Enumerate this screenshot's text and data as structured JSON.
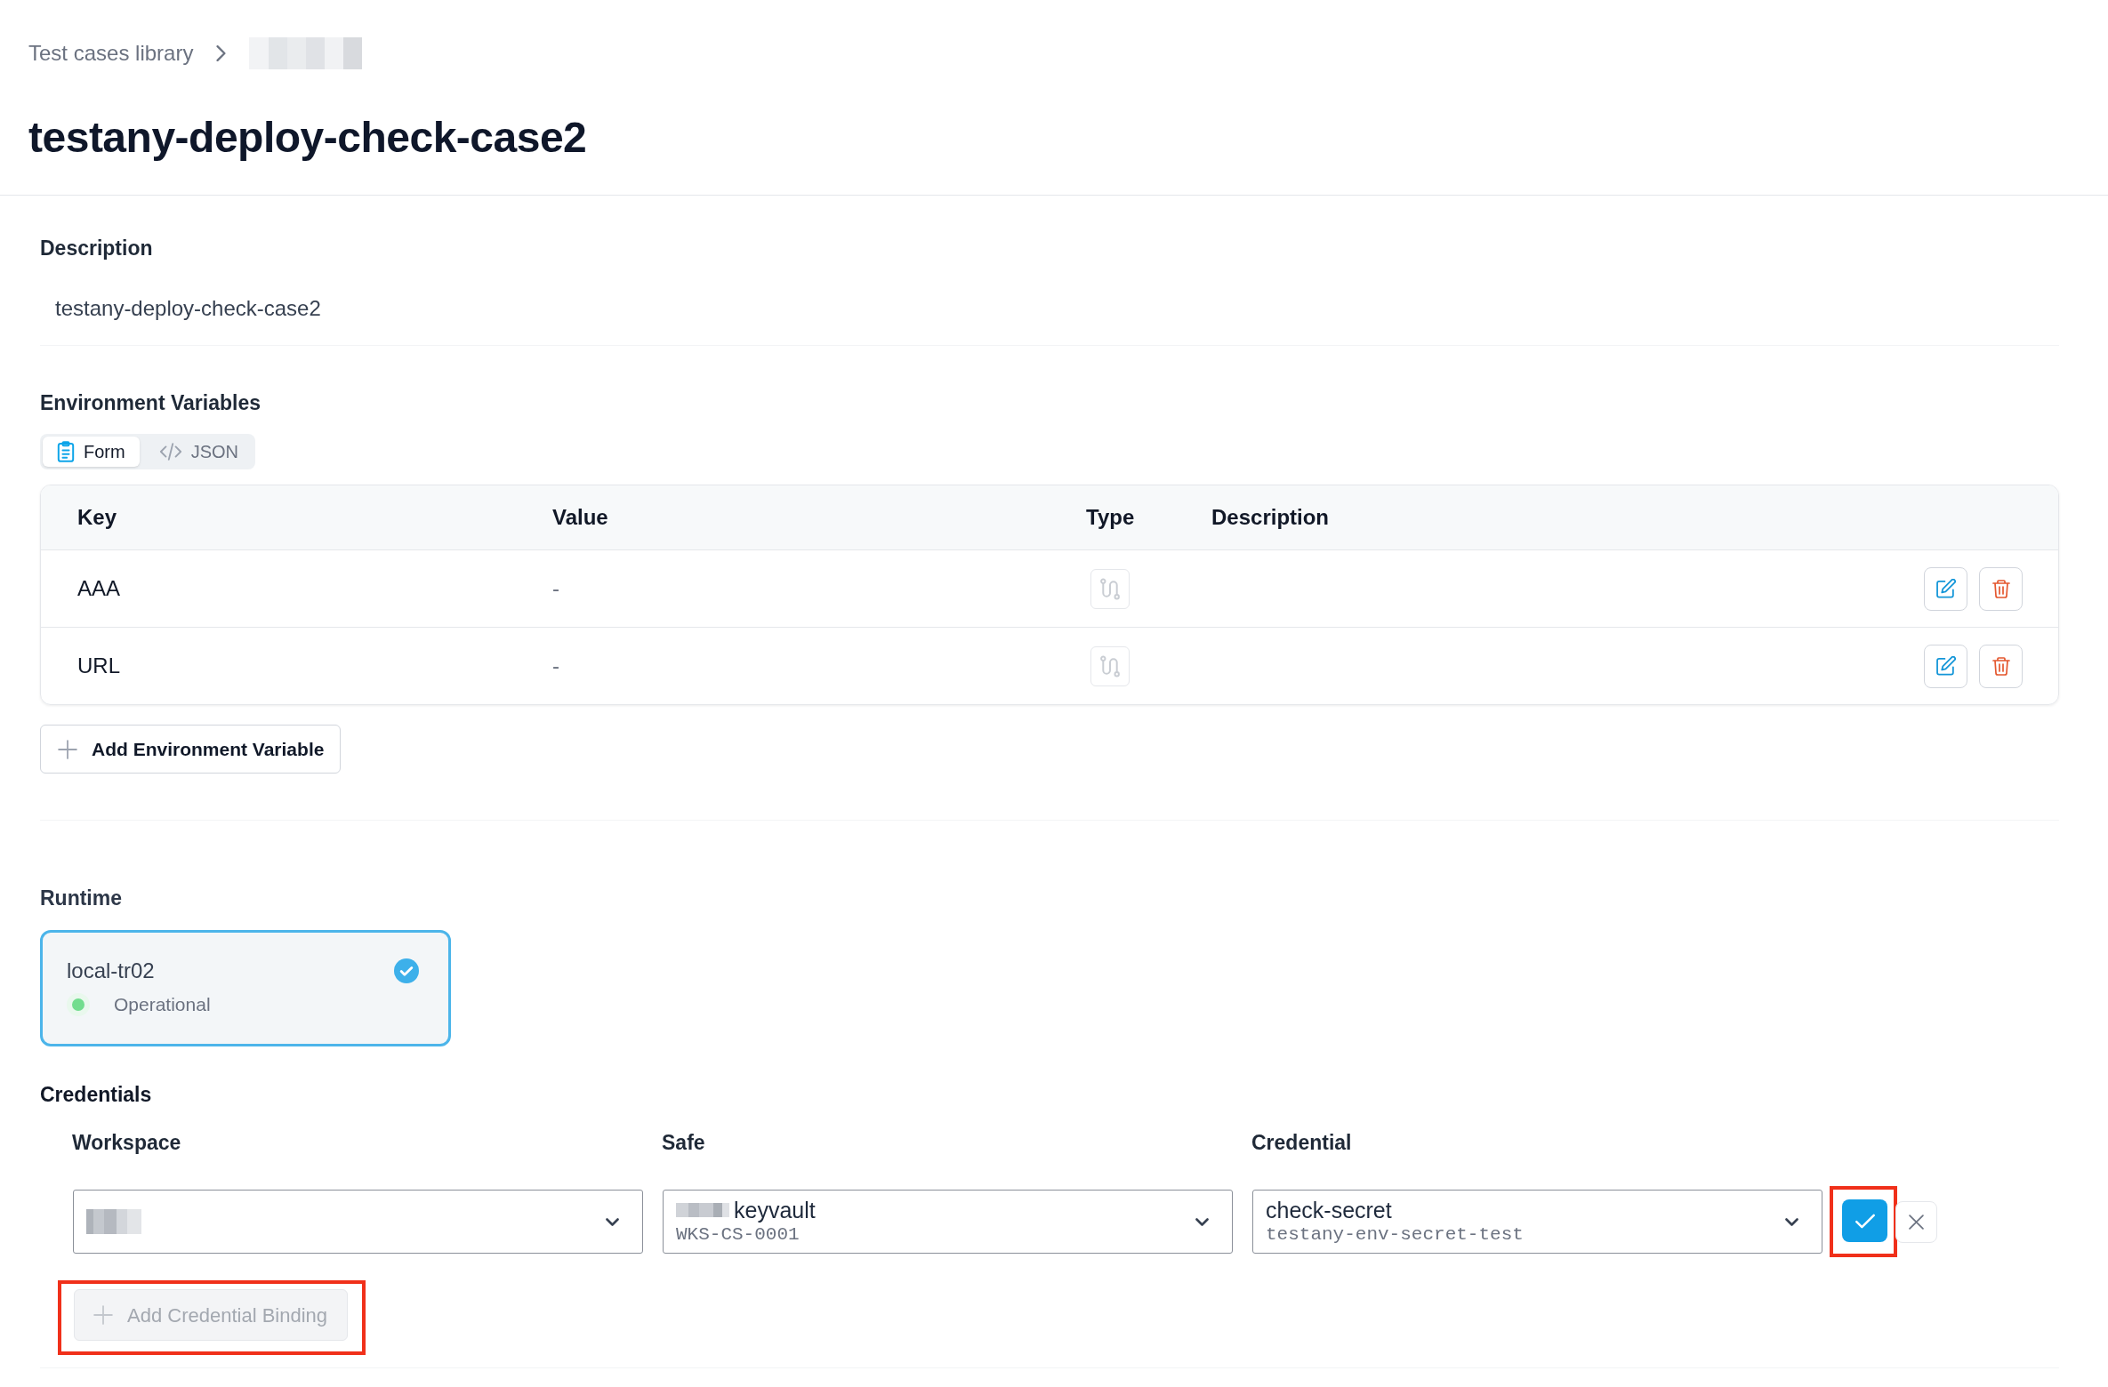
{
  "breadcrumbs": [
    {
      "label": "Test cases library",
      "redacted": false
    },
    {
      "redacted": true
    }
  ],
  "title": "testany-deploy-check-case2",
  "description": {
    "label": "Description",
    "value": "testany-deploy-check-case2"
  },
  "environment_variables": {
    "label": "Environment Variables",
    "tabs": [
      {
        "label": "Form",
        "selected": true
      },
      {
        "label": "JSON",
        "selected": false
      }
    ],
    "table": {
      "columns": [
        "Key",
        "Value",
        "Type",
        "Description"
      ],
      "rows": [
        {
          "key": "AAA",
          "value": "-"
        },
        {
          "key": "URL",
          "value": "-"
        }
      ]
    },
    "add_button": {
      "label": "Add Environment Variable",
      "disabled": false
    }
  },
  "runtime": {
    "label": "Runtime",
    "options": [
      {
        "name": "local-tr02",
        "status": "Operational",
        "color": "#72dd8e",
        "selected": true
      }
    ]
  },
  "credentials": {
    "label": "Credentials",
    "columns": [
      "Workspace",
      "Safe",
      "Credential"
    ],
    "bindings": [
      {
        "fields": [
          {
            "redacted": true
          },
          {
            "redacted": true,
            "value": "keyvault",
            "detail": "WKS-CS-0001"
          },
          {
            "redacted": false,
            "value": "check-secret",
            "detail": "testany-env-secret-test"
          }
        ],
        "confirm_highlighted": true
      }
    ],
    "add_button": {
      "label": "Add Credential Binding",
      "disabled": true,
      "highlighted": true
    }
  }
}
